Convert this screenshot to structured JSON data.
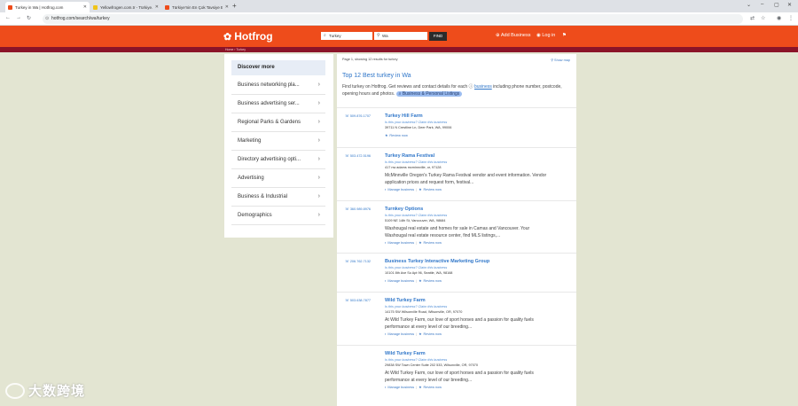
{
  "browser": {
    "tabs": [
      {
        "title": "Turkey in Wa | Hotfrog.com",
        "favicon_color": "#ee4c1b",
        "active": true
      },
      {
        "title": "Yellowfrogen.com.tr - Türkiye...",
        "favicon_color": "#f0c419",
        "active": false
      },
      {
        "title": "Türkiye'nin En Çok Tavsiye Ed...",
        "favicon_color": "#ee4c1b",
        "active": false
      }
    ],
    "new_tab": "+",
    "url": "hotfrog.com/search/wa/turkey",
    "win_controls": [
      "⌄",
      "–",
      "▢",
      "✕"
    ]
  },
  "site": {
    "logo": "Hotfrog",
    "search_what": "Turkey",
    "search_where": "Wa",
    "find_label": "FIND",
    "add_business": "Add Business",
    "login": "Log in",
    "breadcrumb": "Home  ›  Turkey"
  },
  "sidebar": {
    "heading": "Discover more",
    "items": [
      "Business networking pla...",
      "Business advertising ser...",
      "Regional Parks & Gardens",
      "Marketing",
      "Directory advertising opti...",
      "Advertising",
      "Business & Industrial",
      "Demographics"
    ]
  },
  "main": {
    "page_count": "Page 1, showing 12 results for turkey",
    "show_map": "Show map",
    "title": "Top 12 Best turkey in Wa",
    "intro_prefix": "Find turkey on Hotfrog. Get reviews and contact details for each",
    "intro_link": "business",
    "intro_suffix": "including phone number, postcode, opening hours and photos.",
    "intro_pill": "Business & Personal Listings",
    "claim_text": "Is this your business? Claim this business",
    "manage_label": "Manage business",
    "review_label": "Review now",
    "results": [
      {
        "phone": "509.876.1707",
        "name": "Turkey Hill Farm",
        "address": "39711 N Crestline Ln, Deer Park, WA, 99006",
        "desc": [],
        "manage": false
      },
      {
        "phone": "503.472.5196",
        "name": "Turkey Rama Festival",
        "address": "417 nw adams mcminnville, or, 97128",
        "desc": [
          "McMinnville Oregon's Turkey Rama Festival vendor and event information. Vendor",
          "application prices and request form, festival..."
        ],
        "manage": true
      },
      {
        "phone": "360.989.8976",
        "name": "Turnkey Options",
        "address": "5109 NE 14th St, Vancouver, WA, 98684",
        "desc": [
          "Washougal real estate and homes for sale in Camas and Vancouver. Your",
          "Washougal real estate resource center, find MLS listings,..."
        ],
        "manage": true
      },
      {
        "phone": "206.762.7132",
        "name": "Business Turkey Interactive Marketing Group",
        "address": "10101 8th Ave So Apt 96, Seattle, WA, 98168",
        "desc": [],
        "manage": true
      },
      {
        "phone": "503.638.7877",
        "name": "Wild Turkey Farm",
        "address": "14175 SW Wilsonville Road, Wilsonville, OR, 97070",
        "desc": [
          "At Wild Turkey Farm, our love of sport horses and a passion for quality fuels",
          "performance at every level of our breeding..."
        ],
        "manage": true
      },
      {
        "phone": "",
        "name": "Wild Turkey Farm",
        "address": "29838 SW Town Center Suite 202 533, Wilsonville, OR, 97070",
        "desc": [
          "At Wild Turkey Farm, our love of sport horses and a passion for quality fuels",
          "performance at every level of our breeding..."
        ],
        "manage": true
      }
    ]
  },
  "watermark": {
    "text": "大数跨境"
  }
}
